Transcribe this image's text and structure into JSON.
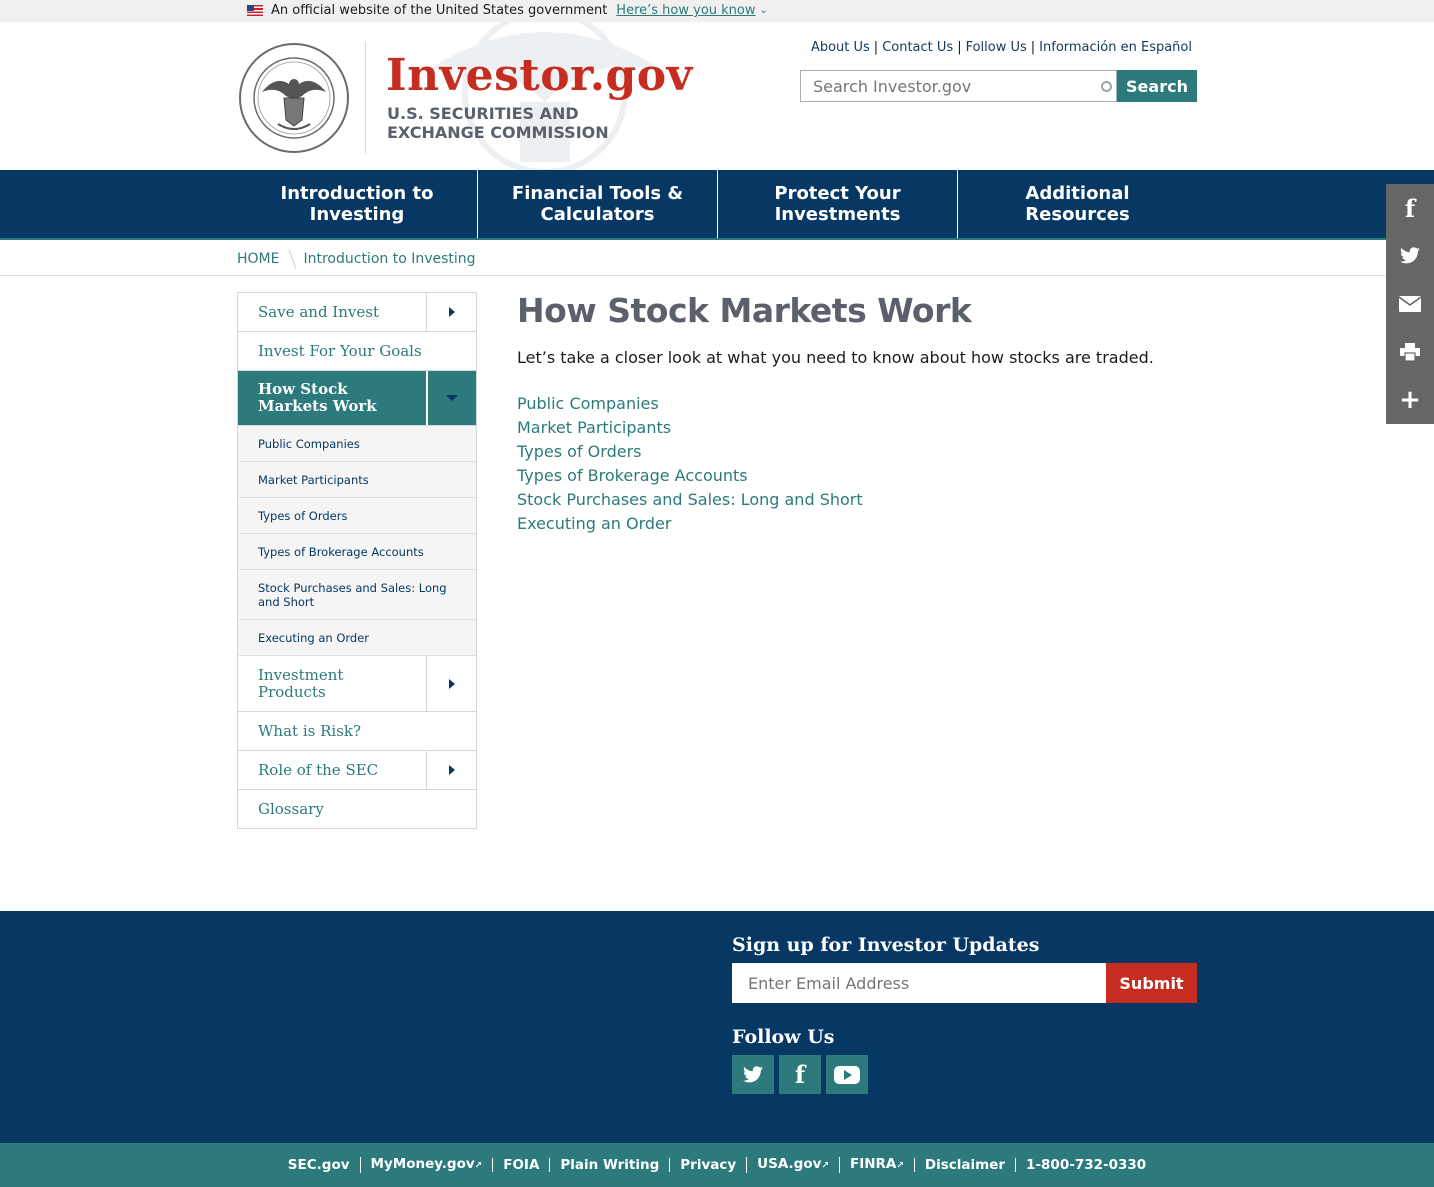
{
  "gov_banner": {
    "text": "An official website of the United States government",
    "link": "Here’s how you know"
  },
  "header": {
    "brand": "Investor.gov",
    "sub_line1": "U.S. SECURITIES AND",
    "sub_line2": "EXCHANGE COMMISSION",
    "utility_links": [
      "About Us",
      "Contact Us",
      "Follow Us",
      "Información en Español"
    ],
    "search_placeholder": "Search Investor.gov",
    "search_button": "Search"
  },
  "main_nav": [
    "Introduction to Investing",
    "Financial Tools & Calculators",
    "Protect Your Investments",
    "Additional Resources"
  ],
  "breadcrumb": {
    "home": "HOME",
    "current": "Introduction to Investing"
  },
  "sidenav": {
    "items": [
      {
        "label": "Save and Invest",
        "expandable": true
      },
      {
        "label": "Invest For Your Goals",
        "expandable": false
      },
      {
        "label": "How Stock Markets Work",
        "expandable": true,
        "active": true
      },
      {
        "label": "Investment Products",
        "expandable": true
      },
      {
        "label": "What is Risk?",
        "expandable": false
      },
      {
        "label": "Role of the SEC",
        "expandable": true
      },
      {
        "label": "Glossary",
        "expandable": false
      }
    ],
    "subitems": [
      "Public Companies",
      "Market Participants",
      "Types of Orders",
      "Types of Brokerage Accounts",
      "Stock Purchases and Sales: Long and Short",
      "Executing an Order"
    ]
  },
  "content": {
    "title": "How Stock Markets Work",
    "lede": "Let’s take a closer look at what you need to know about how stocks are traded.",
    "links": [
      "Public Companies",
      "Market Participants",
      "Types of Orders",
      "Types of Brokerage Accounts",
      "Stock Purchases and Sales: Long and Short",
      "Executing an Order"
    ]
  },
  "share_bar": [
    "facebook-icon",
    "twitter-icon",
    "email-icon",
    "print-icon",
    "plus-icon"
  ],
  "footer": {
    "signup_title": "Sign up for Investor Updates",
    "email_placeholder": "Enter Email Address",
    "submit": "Submit",
    "follow_title": "Follow Us",
    "social": [
      "twitter-icon",
      "facebook-icon",
      "youtube-icon"
    ]
  },
  "bottom_links": [
    "SEC.gov",
    "MyMoney.gov",
    "FOIA",
    "Plain Writing",
    "Privacy",
    "USA.gov",
    "FINRA",
    "Disclaimer",
    "1-800-732-0330"
  ],
  "colors": {
    "navy": "#073763",
    "teal": "#2c7a7b",
    "brand_red": "#c62c1f",
    "gray_text": "#5b616b"
  }
}
